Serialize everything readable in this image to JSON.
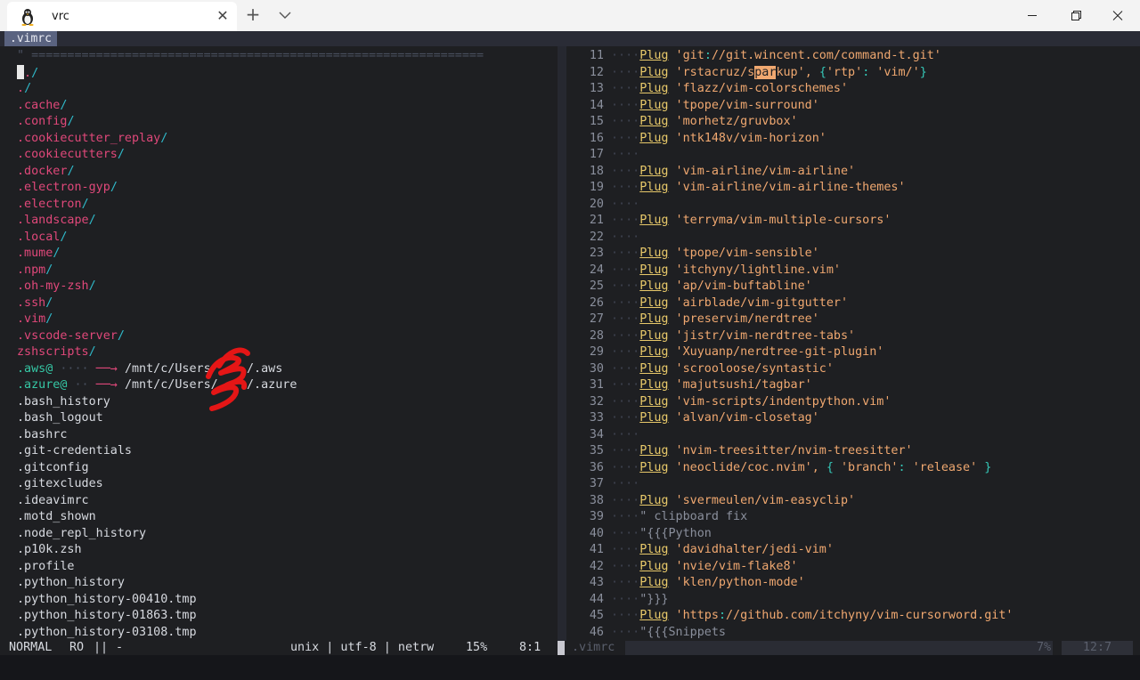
{
  "window": {
    "tab_title": "vrc",
    "tab_icon": "linux-penguin-icon",
    "new_tab_symbol": "+",
    "close_symbol": "✕"
  },
  "buffer": {
    "name": ".vimrc"
  },
  "left_pane": {
    "separator": "\" ===============================================================",
    "entries": [
      {
        "name": "../",
        "kind": "dir"
      },
      {
        "name": "./",
        "kind": "dir"
      },
      {
        "name": ".cache/",
        "kind": "dir"
      },
      {
        "name": ".config/",
        "kind": "dir"
      },
      {
        "name": ".cookiecutter_replay/",
        "kind": "dir"
      },
      {
        "name": ".cookiecutters/",
        "kind": "dir"
      },
      {
        "name": ".docker/",
        "kind": "dir"
      },
      {
        "name": ".electron-gyp/",
        "kind": "dir"
      },
      {
        "name": ".electron/",
        "kind": "dir"
      },
      {
        "name": ".landscape/",
        "kind": "dir"
      },
      {
        "name": ".local/",
        "kind": "dir"
      },
      {
        "name": ".mume/",
        "kind": "dir"
      },
      {
        "name": ".npm/",
        "kind": "dir"
      },
      {
        "name": ".oh-my-zsh/",
        "kind": "dir"
      },
      {
        "name": ".ssh/",
        "kind": "dir"
      },
      {
        "name": ".vim/",
        "kind": "dir"
      },
      {
        "name": ".vscode-server/",
        "kind": "dir"
      },
      {
        "name": "zshscripts/",
        "kind": "dir"
      },
      {
        "name": ".aws@",
        "kind": "link",
        "target": "/mnt/c/Users/    /.aws"
      },
      {
        "name": ".azure@",
        "kind": "link",
        "target": "/mnt/c/Users/    /.azure"
      },
      {
        "name": ".bash_history",
        "kind": "file"
      },
      {
        "name": ".bash_logout",
        "kind": "file"
      },
      {
        "name": ".bashrc",
        "kind": "file"
      },
      {
        "name": ".git-credentials",
        "kind": "file"
      },
      {
        "name": ".gitconfig",
        "kind": "file"
      },
      {
        "name": ".gitexcludes",
        "kind": "file"
      },
      {
        "name": ".ideavimrc",
        "kind": "file"
      },
      {
        "name": ".motd_shown",
        "kind": "file"
      },
      {
        "name": ".node_repl_history",
        "kind": "file"
      },
      {
        "name": ".p10k.zsh",
        "kind": "file"
      },
      {
        "name": ".profile",
        "kind": "file"
      },
      {
        "name": ".python_history",
        "kind": "file"
      },
      {
        "name": ".python_history-00410.tmp",
        "kind": "file"
      },
      {
        "name": ".python_history-01863.tmp",
        "kind": "file"
      },
      {
        "name": ".python_history-03108.tmp",
        "kind": "file"
      }
    ],
    "link_arrow": "──→"
  },
  "right_pane": {
    "lines": [
      {
        "n": "11",
        "kw": "Plug",
        "rest": " 'git://git.wincent.com/command-t.git'"
      },
      {
        "n": "12",
        "kw": "Plug",
        "rest": " 'rstacruz/s",
        "hl": "par",
        "after": "kup', {'rtp': 'vim/'}"
      },
      {
        "n": "13",
        "kw": "Plug",
        "rest": " 'flazz/vim-colorschemes'"
      },
      {
        "n": "14",
        "kw": "Plug",
        "rest": " 'tpope/vim-surround'"
      },
      {
        "n": "15",
        "kw": "Plug",
        "rest": " 'morhetz/gruvbox'"
      },
      {
        "n": "16",
        "kw": "Plug",
        "rest": " 'ntk148v/vim-horizon'"
      },
      {
        "n": "17",
        "kw": "",
        "rest": ""
      },
      {
        "n": "18",
        "kw": "Plug",
        "rest": " 'vim-airline/vim-airline'"
      },
      {
        "n": "19",
        "kw": "Plug",
        "rest": " 'vim-airline/vim-airline-themes'"
      },
      {
        "n": "20",
        "kw": "",
        "rest": ""
      },
      {
        "n": "21",
        "kw": "Plug",
        "rest": " 'terryma/vim-multiple-cursors'"
      },
      {
        "n": "22",
        "kw": "",
        "rest": ""
      },
      {
        "n": "23",
        "kw": "Plug",
        "rest": " 'tpope/vim-sensible'"
      },
      {
        "n": "24",
        "kw": "Plug",
        "rest": " 'itchyny/lightline.vim'"
      },
      {
        "n": "25",
        "kw": "Plug",
        "rest": " 'ap/vim-buftabline'"
      },
      {
        "n": "26",
        "kw": "Plug",
        "rest": " 'airblade/vim-gitgutter'"
      },
      {
        "n": "27",
        "kw": "Plug",
        "rest": " 'preservim/nerdtree'"
      },
      {
        "n": "28",
        "kw": "Plug",
        "rest": " 'jistr/vim-nerdtree-tabs'"
      },
      {
        "n": "29",
        "kw": "Plug",
        "rest": " 'Xuyuanp/nerdtree-git-plugin'"
      },
      {
        "n": "30",
        "kw": "Plug",
        "rest": " 'scrooloose/syntastic'"
      },
      {
        "n": "31",
        "kw": "Plug",
        "rest": " 'majutsushi/tagbar'"
      },
      {
        "n": "32",
        "kw": "Plug",
        "rest": " 'vim-scripts/indentpython.vim'"
      },
      {
        "n": "33",
        "kw": "Plug",
        "rest": " 'alvan/vim-closetag'"
      },
      {
        "n": "34",
        "kw": "",
        "rest": ""
      },
      {
        "n": "35",
        "kw": "Plug",
        "rest": " 'nvim-treesitter/nvim-treesitter'"
      },
      {
        "n": "36",
        "kw": "Plug",
        "rest": " 'neoclide/coc.nvim', { 'branch': 'release' }"
      },
      {
        "n": "37",
        "kw": "",
        "rest": ""
      },
      {
        "n": "38",
        "kw": "Plug",
        "rest": " 'svermeulen/vim-easyclip'"
      },
      {
        "n": "39",
        "kw": "",
        "rest": "\" clipboard fix",
        "comment": true
      },
      {
        "n": "40",
        "kw": "",
        "rest": "\"{{{Python",
        "comment": true
      },
      {
        "n": "41",
        "kw": "Plug",
        "rest": " 'davidhalter/jedi-vim'"
      },
      {
        "n": "42",
        "kw": "Plug",
        "rest": " 'nvie/vim-flake8'"
      },
      {
        "n": "43",
        "kw": "Plug",
        "rest": " 'klen/python-mode'"
      },
      {
        "n": "44",
        "kw": "",
        "rest": "\"}}}",
        "comment": true
      },
      {
        "n": "45",
        "kw": "Plug",
        "rest": " 'https://github.com/itchyny/vim-cursorword.git'"
      },
      {
        "n": "46",
        "kw": "",
        "rest": "\"{{{Snippets",
        "comment": true
      }
    ]
  },
  "status_left": {
    "mode": "NORMAL",
    "ro": "RO",
    "sep": "||",
    "dash": "-",
    "right": "unix | utf-8 | netrw",
    "percent": "15%",
    "position": "8:1"
  },
  "status_right": {
    "file": ".vimrc",
    "percent": "7%",
    "position": "12:7"
  },
  "colors": {
    "dir_name": "#e0487a",
    "dir_slash": "#2fb8c8",
    "symlink": "#35c8a5",
    "keyword": "#e8c96a",
    "string": "#f0a870",
    "background": "#1e1f22"
  }
}
